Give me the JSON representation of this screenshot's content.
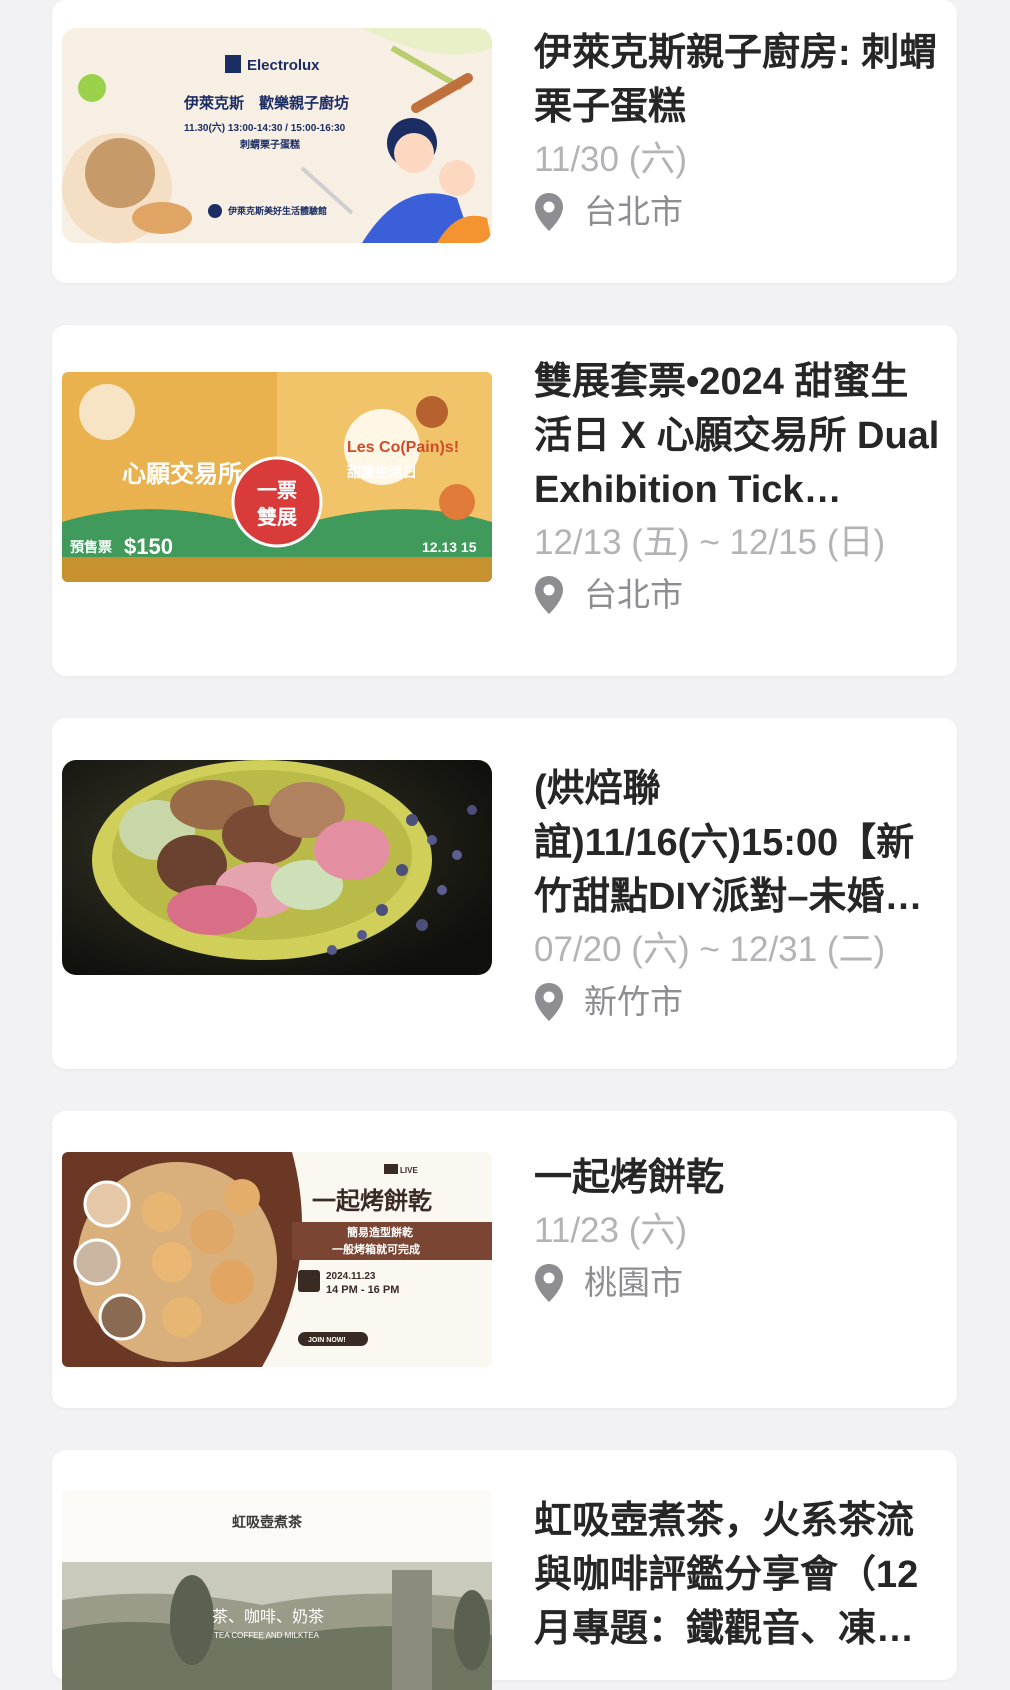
{
  "events": [
    {
      "title": "伊萊克斯親子廚房: 刺蝟栗子蛋糕",
      "date": "11/30 (六)",
      "location": "台北市",
      "banner": {
        "brand": "Electrolux",
        "headline": "伊萊克斯　歡樂親子廚坊",
        "schedule": "11.30(六)  13:00-14:30 / 15:00-16:30",
        "dish": "刺蝟栗子蛋糕",
        "venue": "伊萊克斯美好生活體驗館"
      }
    },
    {
      "title": "雙展套票•2024 甜蜜生活日 X 心願交易所 Dual Exhibition Tick…",
      "date": "12/13 (五) ~ 12/15 (日)",
      "location": "台北市",
      "banner": {
        "left": "心願交易所",
        "badge_top": "一票",
        "badge_bottom": "雙展",
        "right": "Les Co(Pain)s!",
        "right_sub": "甜蜜生活日",
        "presale": "預售票",
        "price": "$150",
        "dates": "12.13 15"
      }
    },
    {
      "title": "(烘焙聯誼)11/16(六)15:00【新竹甜點DIY派對–未婚…",
      "date": "07/20 (六) ~ 12/31 (二)",
      "location": "新竹市"
    },
    {
      "title": "一起烤餅乾",
      "date": "11/23 (六)",
      "location": "桃園市",
      "banner": {
        "live": "LIVE",
        "headline": "一起烤餅乾",
        "line1": "簡易造型餅乾",
        "line2": "一般烤箱就可完成",
        "when": "2024.11.23",
        "time": "14 PM - 16 PM",
        "join": "JOIN NOW!"
      }
    },
    {
      "title": "虹吸壺煮茶，火系茶流與咖啡評鑑分享會（12月專題：鐵觀音、凍…",
      "date": "",
      "location": "",
      "banner": {
        "top": "虹吸壺煮茶",
        "mid": "茶、咖啡、奶茶",
        "sub": "TEA COFFEE AND MILKTEA"
      }
    }
  ],
  "icons": {
    "location": "map-pin-icon"
  },
  "colors": {
    "title": "#262626",
    "date": "#b3b3b6",
    "location": "#8e8e92",
    "bg": "#f2f2f4"
  }
}
